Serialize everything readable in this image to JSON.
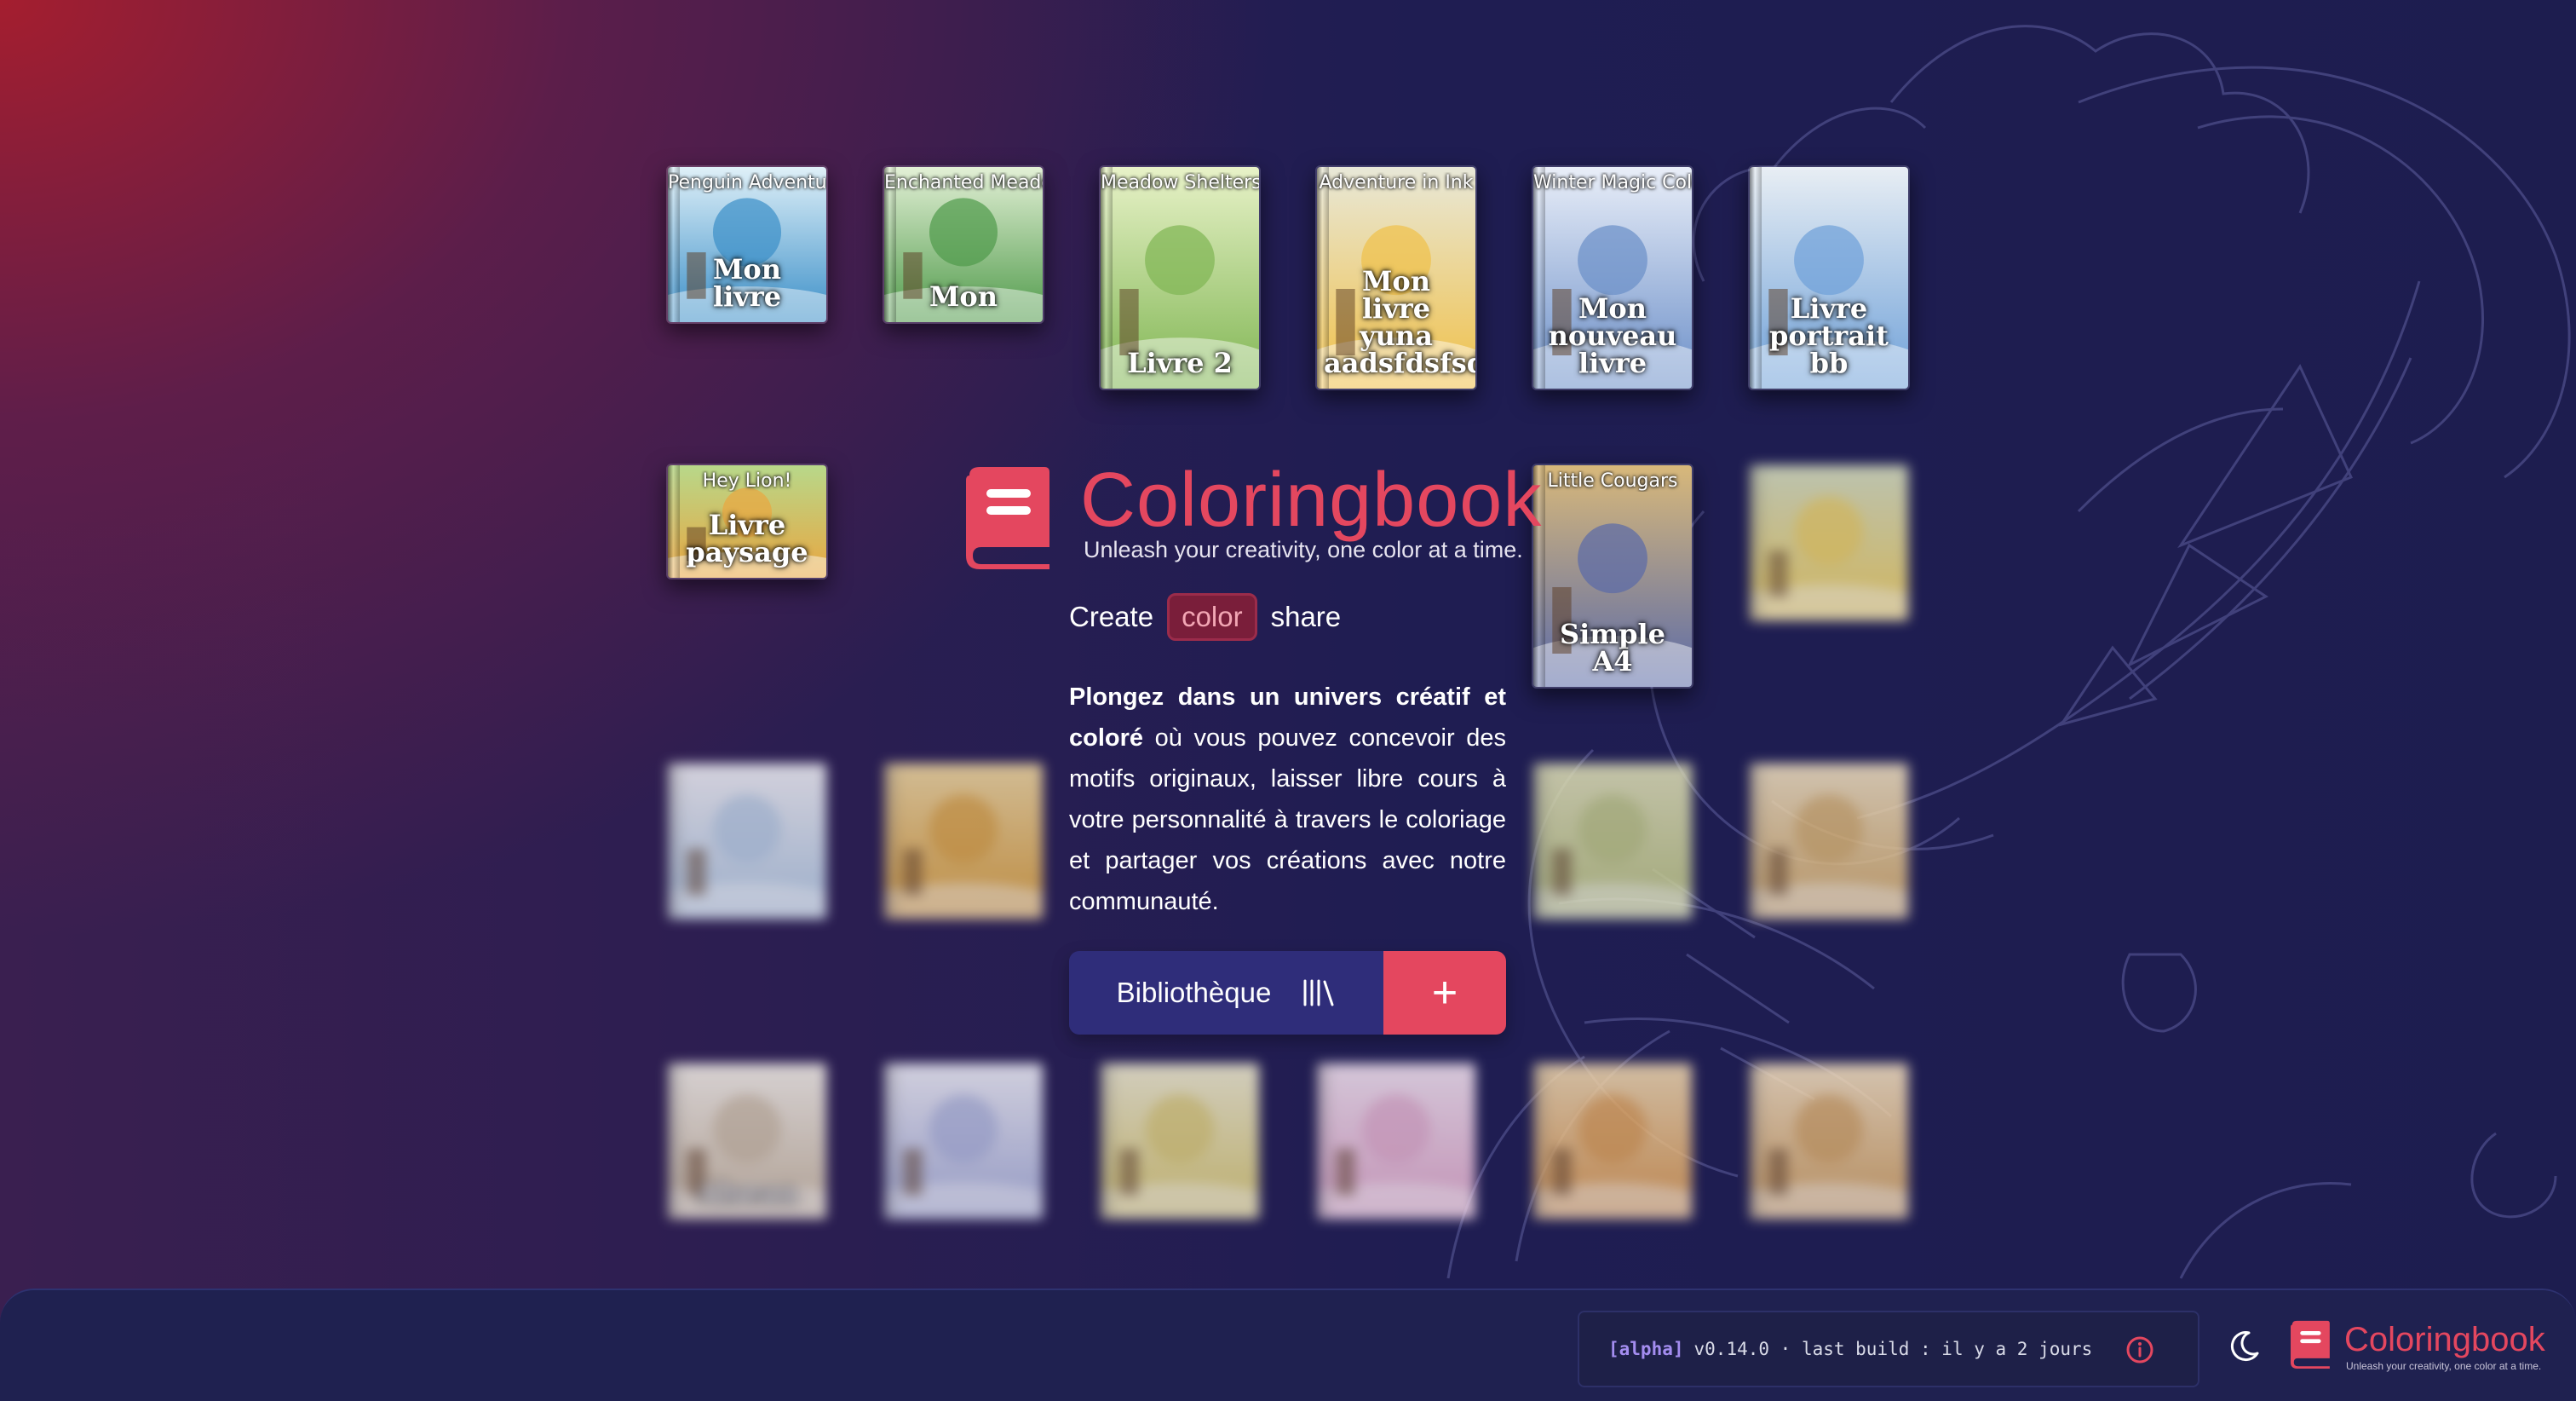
{
  "brand": {
    "title": "Coloringbook",
    "tagline": "Unleash your creativity, one color at a time."
  },
  "motto": {
    "w1": "Create",
    "w2": "color",
    "w3": "share"
  },
  "description": {
    "bold": "Plongez dans un univers créatif et coloré",
    "rest": " où vous pouvez concevoir des motifs originaux, laisser libre cours à votre personnalité à travers le coloriage et partager vos créations avec notre communauté."
  },
  "actions": {
    "library_label": "Bibliothèque",
    "add_label": "+"
  },
  "books": [
    {
      "cover_title": "Penguin Adventures",
      "name": "Mon livre"
    },
    {
      "cover_title": "Enchanted Meadow",
      "name": "Mon"
    },
    {
      "cover_title": "Meadow Shelters",
      "name": "Livre 2"
    },
    {
      "cover_title": "Adventure in Ink",
      "name": "Mon livre yuna aadsfdsfsd"
    },
    {
      "cover_title": "Winter Magic Coloring Book",
      "name": "Mon nouveau livre"
    },
    {
      "cover_title": "",
      "name": "Livre portrait bb"
    },
    {
      "cover_title": "Hey Lion!",
      "name": "Livre paysage"
    },
    {
      "cover_title": "Little Cougars",
      "name": "Simple A4"
    },
    {
      "cover_title": "",
      "name": ""
    },
    {
      "cover_title": "",
      "name": ""
    },
    {
      "cover_title": "",
      "name": ""
    },
    {
      "cover_title": "",
      "name": ""
    },
    {
      "cover_title": "",
      "name": ""
    },
    {
      "cover_title": "",
      "name": "Alsean"
    },
    {
      "cover_title": "",
      "name": ""
    },
    {
      "cover_title": "",
      "name": ""
    },
    {
      "cover_title": "",
      "name": ""
    },
    {
      "cover_title": "",
      "name": ""
    },
    {
      "cover_title": "",
      "name": ""
    }
  ],
  "footer": {
    "build_tag": "[alpha]",
    "build_text": "v0.14.0 · last build : il y a 2 jours",
    "logo_title": "Coloringbook",
    "logo_tagline": "Unleash your creativity, one color at a time."
  },
  "icons": {
    "logo": "book-icon",
    "library": "library-icon",
    "add": "plus-icon",
    "info": "info-icon",
    "theme": "moon-icon"
  },
  "colors": {
    "accent": "#e4475f",
    "primary": "#2f2d7a",
    "alpha": "#a48df0"
  }
}
